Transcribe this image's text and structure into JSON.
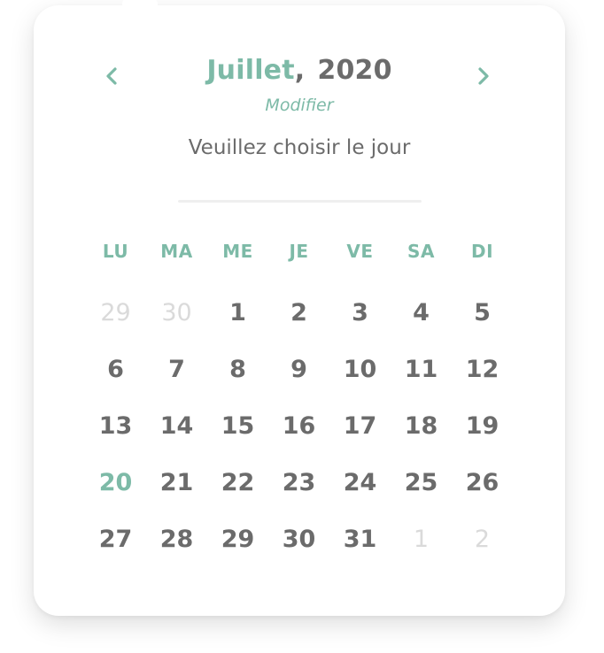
{
  "header": {
    "month": "Juillet",
    "separator": ",",
    "year": "2020",
    "modify_label": "Modifier",
    "prompt": "Veuillez choisir le jour",
    "prev_icon": "chevron-left-icon",
    "next_icon": "chevron-right-icon"
  },
  "weekdays": [
    "LU",
    "MA",
    "ME",
    "JE",
    "VE",
    "SA",
    "DI"
  ],
  "days": [
    {
      "label": "29",
      "state": "muted"
    },
    {
      "label": "30",
      "state": "muted"
    },
    {
      "label": "1",
      "state": "normal"
    },
    {
      "label": "2",
      "state": "normal"
    },
    {
      "label": "3",
      "state": "normal"
    },
    {
      "label": "4",
      "state": "normal"
    },
    {
      "label": "5",
      "state": "normal"
    },
    {
      "label": "6",
      "state": "normal"
    },
    {
      "label": "7",
      "state": "normal"
    },
    {
      "label": "8",
      "state": "normal"
    },
    {
      "label": "9",
      "state": "normal"
    },
    {
      "label": "10",
      "state": "normal"
    },
    {
      "label": "11",
      "state": "normal"
    },
    {
      "label": "12",
      "state": "normal"
    },
    {
      "label": "13",
      "state": "normal"
    },
    {
      "label": "14",
      "state": "normal"
    },
    {
      "label": "15",
      "state": "normal"
    },
    {
      "label": "16",
      "state": "normal"
    },
    {
      "label": "17",
      "state": "normal"
    },
    {
      "label": "18",
      "state": "normal"
    },
    {
      "label": "19",
      "state": "normal"
    },
    {
      "label": "20",
      "state": "today"
    },
    {
      "label": "21",
      "state": "normal"
    },
    {
      "label": "22",
      "state": "normal"
    },
    {
      "label": "23",
      "state": "normal"
    },
    {
      "label": "24",
      "state": "normal"
    },
    {
      "label": "25",
      "state": "normal"
    },
    {
      "label": "26",
      "state": "normal"
    },
    {
      "label": "27",
      "state": "normal"
    },
    {
      "label": "28",
      "state": "normal"
    },
    {
      "label": "29",
      "state": "normal"
    },
    {
      "label": "30",
      "state": "normal"
    },
    {
      "label": "31",
      "state": "normal"
    },
    {
      "label": "1",
      "state": "muted"
    },
    {
      "label": "2",
      "state": "muted"
    }
  ],
  "colors": {
    "accent": "#7dbaa7",
    "text": "#6b6b6b",
    "muted": "#dadada",
    "divider": "#efefef"
  }
}
